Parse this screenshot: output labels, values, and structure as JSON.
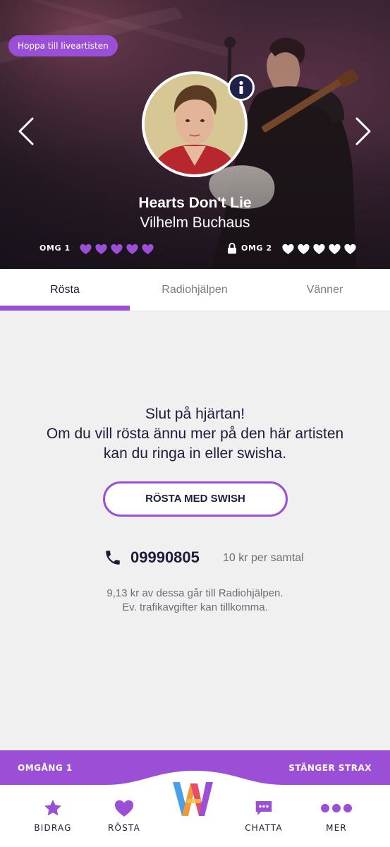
{
  "hero": {
    "live_button": "Hoppa till liveartisten",
    "song_title": "Hearts Don't Lie",
    "artist": "Vilhelm Buchaus",
    "round1_label": "OMG 1",
    "round2_label": "OMG 2",
    "round1_hearts": 5,
    "round2_hearts": 5,
    "round1_heart_color": "#9b4fd6",
    "round2_heart_color": "#ffffff",
    "round2_locked": true
  },
  "tabs": [
    {
      "label": "Rösta",
      "active": true
    },
    {
      "label": "Radiohjälpen",
      "active": false
    },
    {
      "label": "Vänner",
      "active": false
    }
  ],
  "message": {
    "line1": "Slut på hjärtan!",
    "line2": "Om du vill rösta ännu mer på den här artisten",
    "line3": "kan du ringa in eller swisha."
  },
  "swish_button": "RÖSTA MED SWISH",
  "phone": {
    "icon": "phone-icon",
    "number": "09990805",
    "cost": "10 kr per samtal"
  },
  "note": {
    "line1": "9,13 kr av dessa går till Radiohjälpen.",
    "line2": "Ev. trafikavgifter kan tillkomma."
  },
  "round_bar": {
    "left": "OMGÅNG 1",
    "right": "STÄNGER STRAX"
  },
  "bottom_nav": [
    {
      "label": "BIDRAG",
      "icon": "star-icon"
    },
    {
      "label": "RÖSTA",
      "icon": "heart-icon"
    },
    {
      "label": "CHATTA",
      "icon": "chat-icon"
    },
    {
      "label": "MER",
      "icon": "more-dots-icon"
    }
  ],
  "colors": {
    "accent": "#9b4fd6",
    "dark_text": "#1b1d3a",
    "info_button": "#1f2148"
  }
}
